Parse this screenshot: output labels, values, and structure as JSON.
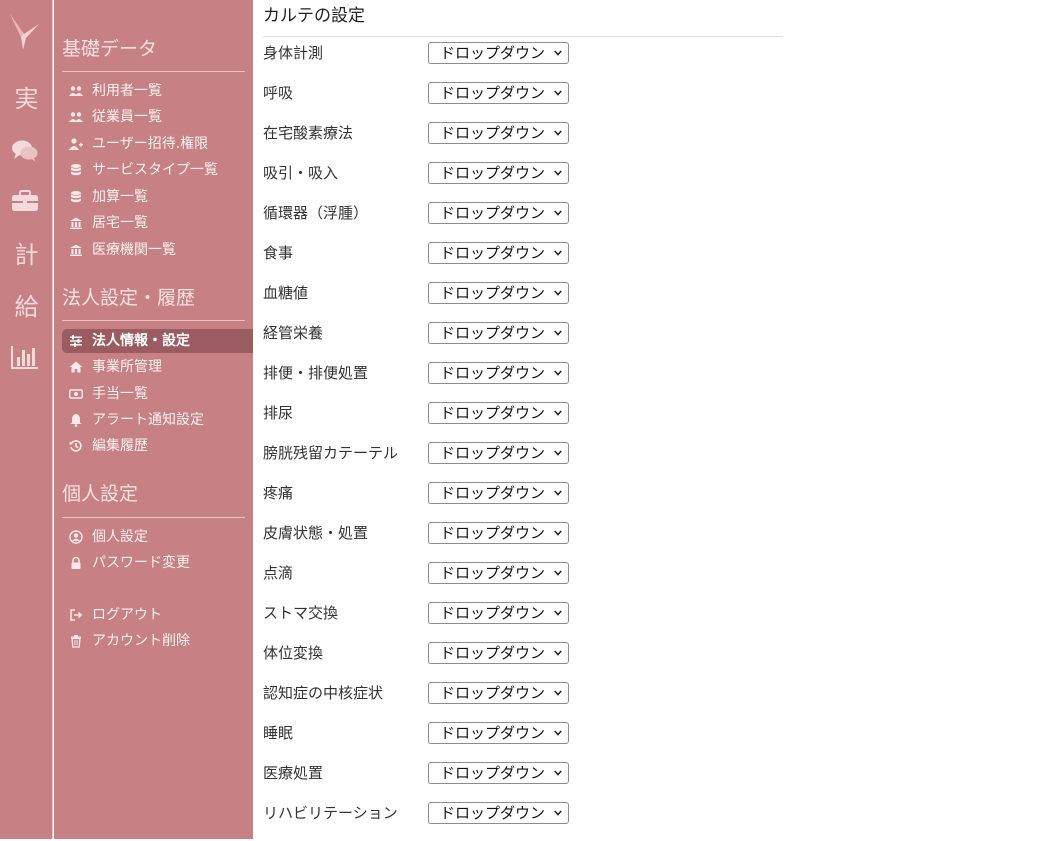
{
  "rail": {
    "items": [
      "実",
      "計",
      "給"
    ]
  },
  "sidebar": {
    "sections": [
      {
        "title": "基礎データ",
        "items": [
          {
            "label": "利用者一覧",
            "icon": "users-icon"
          },
          {
            "label": "従業員一覧",
            "icon": "users-icon"
          },
          {
            "label": "ユーザー招待.権限",
            "icon": "user-plus-icon"
          },
          {
            "label": "サービスタイプ一覧",
            "icon": "database-icon"
          },
          {
            "label": "加算一覧",
            "icon": "database-icon"
          },
          {
            "label": "居宅一覧",
            "icon": "building-icon"
          },
          {
            "label": "医療機関一覧",
            "icon": "building-icon"
          }
        ]
      },
      {
        "title": "法人設定・履歴",
        "items": [
          {
            "label": "法人情報・設定",
            "icon": "sliders-icon",
            "active": true
          },
          {
            "label": "事業所管理",
            "icon": "home-icon"
          },
          {
            "label": "手当一覧",
            "icon": "money-icon"
          },
          {
            "label": "アラート通知設定",
            "icon": "bell-icon"
          },
          {
            "label": "編集履歴",
            "icon": "history-icon"
          }
        ]
      },
      {
        "title": "個人設定",
        "items": [
          {
            "label": "個人設定",
            "icon": "user-circle-icon"
          },
          {
            "label": "パスワード変更",
            "icon": "lock-icon"
          }
        ]
      }
    ],
    "footer": [
      {
        "label": "ログアウト",
        "icon": "logout-icon"
      },
      {
        "label": "アカウント削除",
        "icon": "trash-icon"
      }
    ]
  },
  "main": {
    "title": "カルテの設定",
    "select_value": "ドロップダウン",
    "fields": [
      "身体計測",
      "呼吸",
      "在宅酸素療法",
      "吸引・吸入",
      "循環器（浮腫）",
      "食事",
      "血糖値",
      "経管栄養",
      "排便・排便処置",
      "排尿",
      "膀胱残留カテーテル",
      "疼痛",
      "皮膚状態・処置",
      "点滴",
      "ストマ交換",
      "体位変換",
      "認知症の中核症状",
      "睡眠",
      "医療処置",
      "リハビリテーション"
    ]
  },
  "colors": {
    "sidebar_bg": "#c78083",
    "active_bg": "#9a5c60",
    "text": "#333333"
  }
}
